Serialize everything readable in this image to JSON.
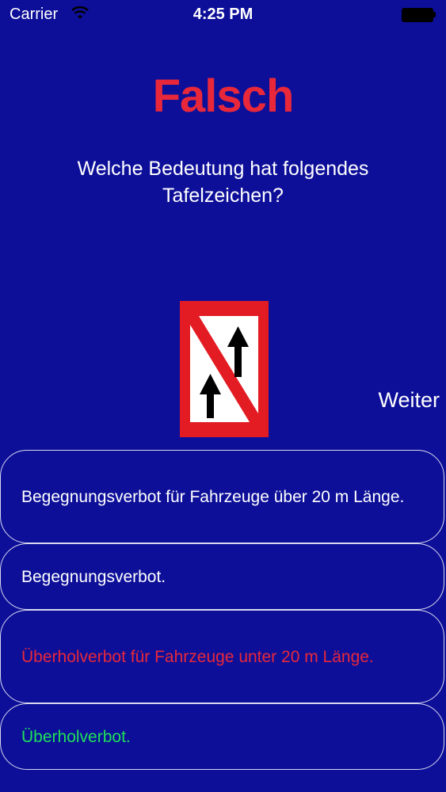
{
  "status_bar": {
    "carrier": "Carrier",
    "time": "4:25 PM"
  },
  "result": {
    "title": "Falsch",
    "color": "#e8283a"
  },
  "question": {
    "text": "Welche Bedeutung hat folgendes Tafelzeichen?"
  },
  "sign": {
    "icon": "no-overtaking-sign-icon",
    "border_color": "#e31b23"
  },
  "navigation": {
    "next_label": "Weiter"
  },
  "answers": [
    {
      "text": "Begegnungsverbot für Fahrzeuge über 20 m Länge.",
      "color": "#ffffff"
    },
    {
      "text": "Begegnungsverbot.",
      "color": "#ffffff"
    },
    {
      "text": "Überholverbot für Fahrzeuge unter 20 m Länge.",
      "color": "#e8283a"
    },
    {
      "text": "Überholverbot.",
      "color": "#1fe05a"
    }
  ],
  "colors": {
    "background": "#0d0f99",
    "wrong": "#e8283a",
    "correct": "#1fe05a"
  }
}
